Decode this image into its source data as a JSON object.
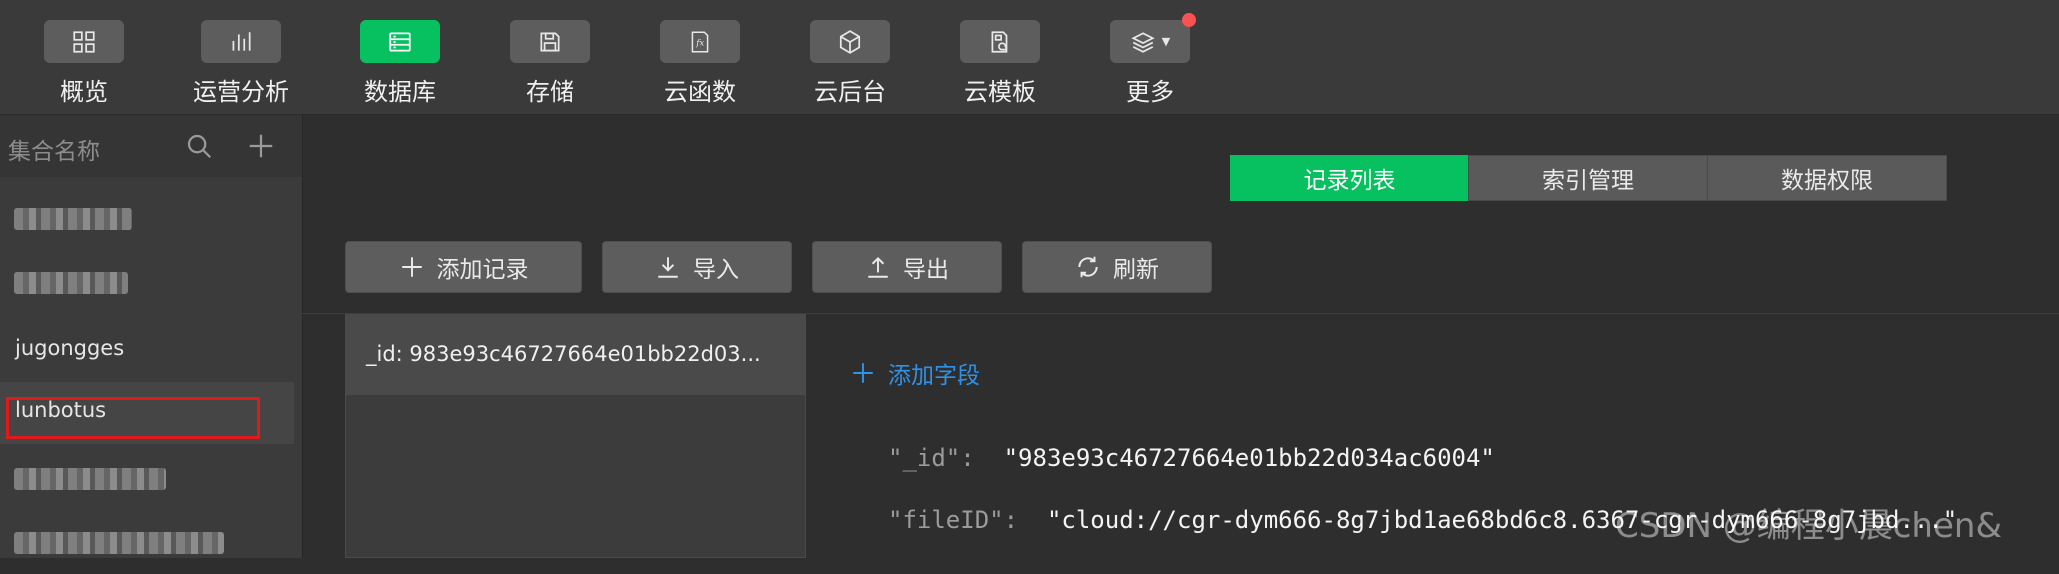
{
  "toolbar": {
    "items": [
      {
        "label": "概览",
        "icon": "grid-icon"
      },
      {
        "label": "运营分析",
        "icon": "bar-chart-icon"
      },
      {
        "label": "数据库",
        "icon": "database-icon"
      },
      {
        "label": "存储",
        "icon": "save-disk-icon"
      },
      {
        "label": "云函数",
        "icon": "function-icon"
      },
      {
        "label": "云后台",
        "icon": "cube-icon"
      },
      {
        "label": "云模板",
        "icon": "template-icon"
      },
      {
        "label": "更多",
        "icon": "layers-icon"
      }
    ],
    "active_index": 2
  },
  "sidebar": {
    "title": "集合名称",
    "collections": [
      {
        "name": "jugongges"
      },
      {
        "name": "lunbotus"
      }
    ]
  },
  "tabs": [
    {
      "label": "记录列表"
    },
    {
      "label": "索引管理"
    },
    {
      "label": "数据权限"
    }
  ],
  "actions": {
    "add_record": "添加记录",
    "import": "导入",
    "export": "导出",
    "refresh": "刷新"
  },
  "records": [
    {
      "label": "_id: 983e93c46727664e01bb22d03..."
    }
  ],
  "document": {
    "add_field": "添加字段",
    "fields": [
      {
        "key": "\"_id\":",
        "value": "\"983e93c46727664e01bb22d034ac6004\""
      },
      {
        "key": "\"fileID\":",
        "value": "\"cloud://cgr-dym666-8g7jbd1ae68bd6c8.6367-cgr-dym666-8g7jbd...\""
      }
    ]
  },
  "watermark": "CSDN @编程小晨chen&",
  "colors": {
    "accent": "#07c160",
    "link": "#2e93e8",
    "highlight": "#e0191b",
    "notification": "#fa5151"
  }
}
